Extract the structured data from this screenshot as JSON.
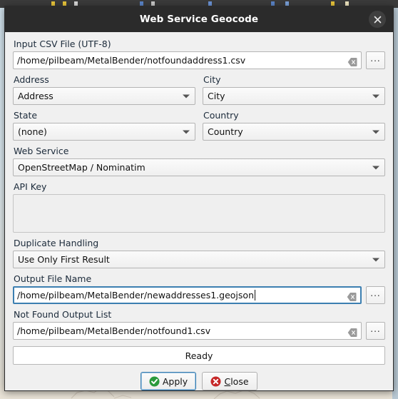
{
  "window": {
    "title": "Web Service Geocode",
    "close_icon": "close-icon"
  },
  "form": {
    "input_csv": {
      "label": "Input CSV File (UTF-8)",
      "value": "/home/pilbeam/MetalBender/notfoundaddress1.csv",
      "clear_icon": "clear-icon",
      "browse_label": "...",
      "focused": false
    },
    "address": {
      "label": "Address",
      "value": "Address"
    },
    "city": {
      "label": "City",
      "value": "City"
    },
    "state": {
      "label": "State",
      "value": "(none)"
    },
    "country": {
      "label": "Country",
      "value": "Country"
    },
    "web_service": {
      "label": "Web Service",
      "value": "OpenStreetMap / Nominatim"
    },
    "api_key": {
      "label": "API Key",
      "value": "",
      "placeholder": ""
    },
    "duplicate_handling": {
      "label": "Duplicate Handling",
      "value": "Use Only First Result"
    },
    "output_file": {
      "label": "Output File Name",
      "value": "/home/pilbeam/MetalBender/newaddresses1.geojson",
      "clear_icon": "clear-icon",
      "browse_label": "...",
      "focused": true
    },
    "not_found_output": {
      "label": "Not Found Output List",
      "value": "/home/pilbeam/MetalBender/notfound1.csv",
      "clear_icon": "clear-icon",
      "browse_label": "...",
      "focused": false
    }
  },
  "status": {
    "text": "Ready"
  },
  "buttons": {
    "apply": {
      "label": "Apply",
      "icon": "check-circle-icon",
      "icon_color": "#2a9a3c",
      "focused": true
    },
    "close": {
      "label": "Close",
      "label_prefix": "C",
      "label_rest": "lose",
      "icon": "x-circle-icon",
      "icon_color": "#c62828",
      "focused": false
    }
  },
  "colors": {
    "titlebar": "#2b2b2b",
    "dialog_bg": "#f0f0f0",
    "focus_border": "#3c7fb1",
    "label_text": "#1b2a3a",
    "desktop_bg": "#dfe9ef"
  }
}
